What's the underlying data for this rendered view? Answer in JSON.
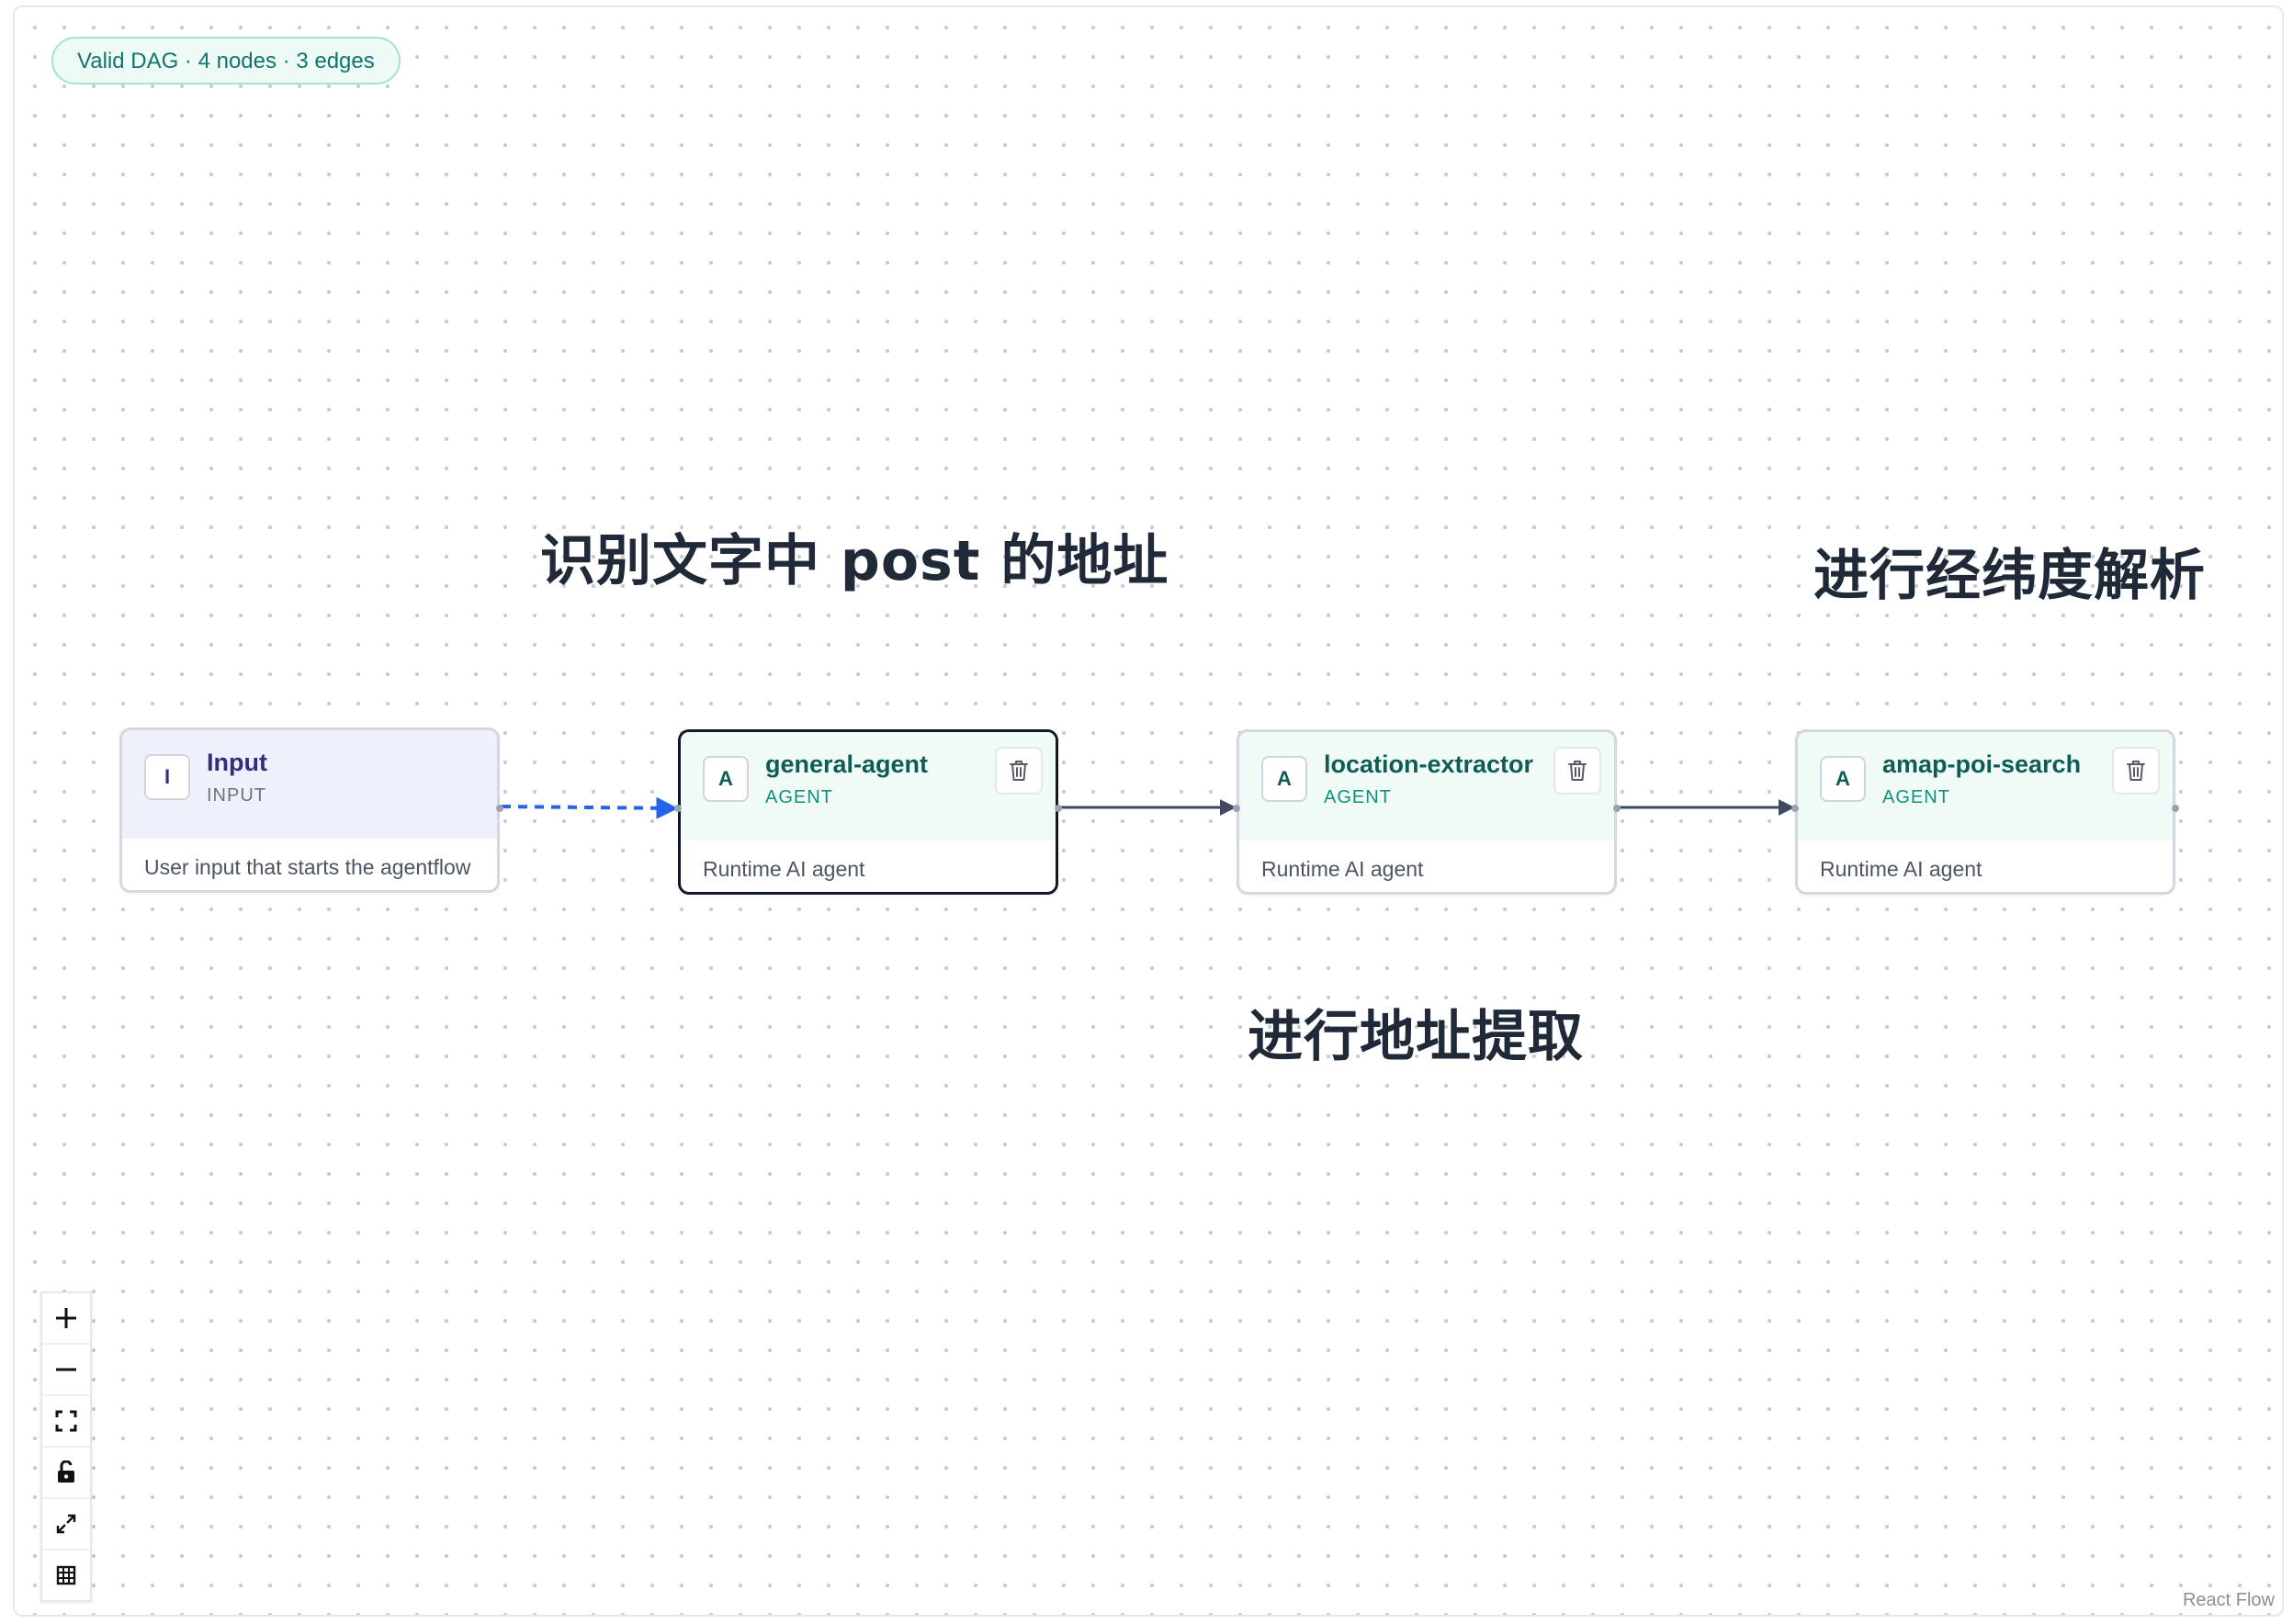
{
  "status": {
    "text": "Valid DAG · 4 nodes · 3 edges"
  },
  "annotations": [
    "识别文字中 post 的地址",
    "进行经纬度解析",
    "进行地址提取"
  ],
  "nodes": [
    {
      "badge": "I",
      "title": "Input",
      "type": "INPUT",
      "description": "User input that starts the agentflow"
    },
    {
      "badge": "A",
      "title": "general-agent",
      "type": "AGENT",
      "description": "Runtime AI agent"
    },
    {
      "badge": "A",
      "title": "location-extractor",
      "type": "AGENT",
      "description": "Runtime AI agent"
    },
    {
      "badge": "A",
      "title": "amap-poi-search",
      "type": "AGENT",
      "description": "Runtime AI agent"
    }
  ],
  "controls": {
    "zoom_in_icon": "plus-icon",
    "zoom_out_icon": "minus-icon",
    "fit_view_icon": "fit-view-icon",
    "lock_icon": "unlock-icon",
    "fullscreen_icon": "expand-icon",
    "minimap_icon": "grid-icon"
  },
  "attribution": "React Flow",
  "colors": {
    "status_green": "#0f766e",
    "agent_header": "#f0fbf8",
    "input_header": "#eef1fc",
    "animated_edge": "#2563eb",
    "edge": "#3f4a5e"
  }
}
